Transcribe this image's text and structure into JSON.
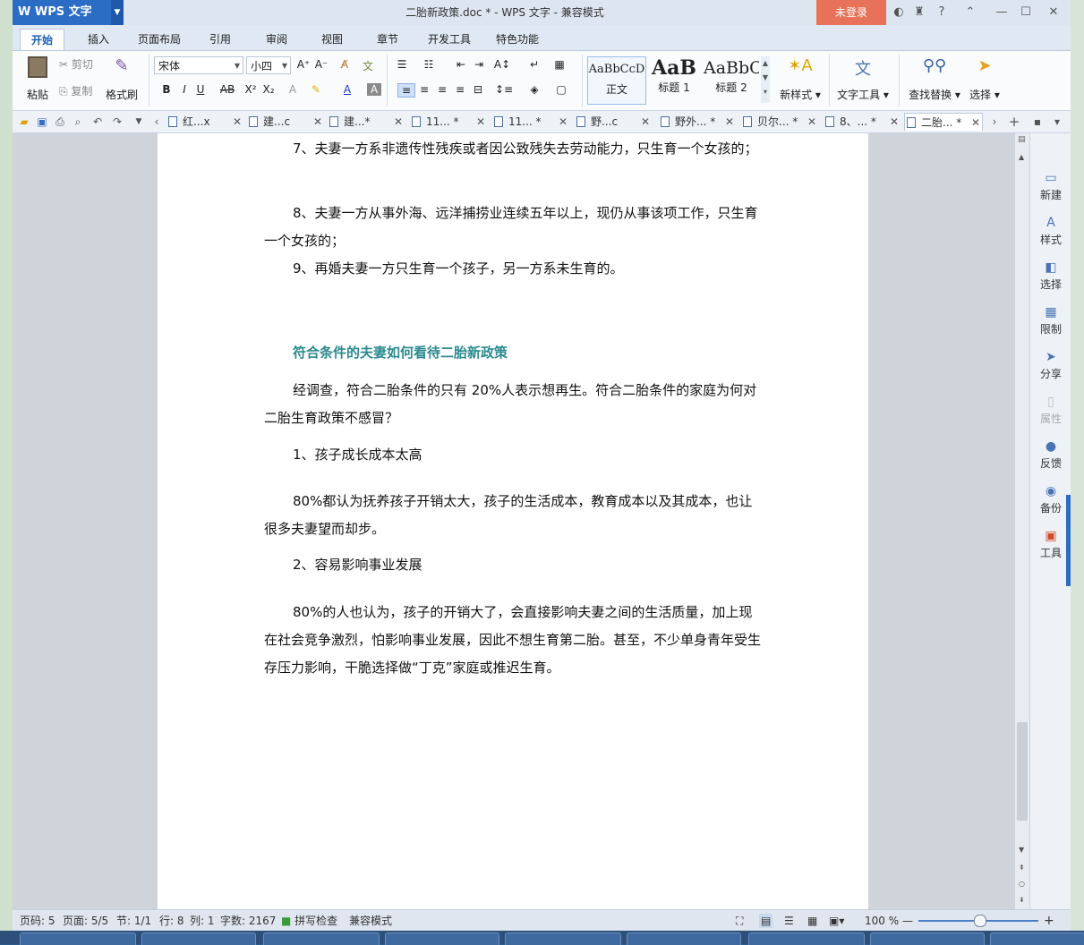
{
  "app": {
    "logo": "WPS 文字",
    "title": "二胎新政策.doc * - WPS 文字 - 兼容模式",
    "login_label": "未登录"
  },
  "menu_tabs": [
    "开始",
    "插入",
    "页面布局",
    "引用",
    "审阅",
    "视图",
    "章节",
    "开发工具",
    "特色功能"
  ],
  "ribbon": {
    "paste": "粘贴",
    "cut": "剪切",
    "copy": "复制",
    "format_painter": "格式刷",
    "font_name": "宋体",
    "font_size": "小四",
    "styles": [
      {
        "sample": "AaBbCcD",
        "label": "正文"
      },
      {
        "sample": "AaB",
        "label": "标题 1"
      },
      {
        "sample": "AaBbC",
        "label": "标题 2"
      }
    ],
    "new_style": "新样式",
    "text_tools": "文字工具",
    "find_replace": "查找替换",
    "select": "选择"
  },
  "doc_tabs": [
    {
      "label": "红...x",
      "active": false
    },
    {
      "label": "建...c",
      "active": false
    },
    {
      "label": "建...*",
      "active": false
    },
    {
      "label": "11... *",
      "active": false
    },
    {
      "label": "11... *",
      "active": false
    },
    {
      "label": "野...c",
      "active": false
    },
    {
      "label": "野外... *",
      "active": false
    },
    {
      "label": "贝尔... *",
      "active": false
    },
    {
      "label": "8、... *",
      "active": false
    },
    {
      "label": "二胎... *",
      "active": true
    }
  ],
  "document": {
    "paragraphs": [
      {
        "text": "7、夫妻一方系非遗传性残疾或者因公致残失去劳动能力，只生育一个女孩的；",
        "heading": false
      },
      {
        "text": "8、夫妻一方从事外海、远洋捕捞业连续五年以上，现仍从事该项工作，只生育一个女孩的；",
        "heading": false
      },
      {
        "text": "9、再婚夫妻一方只生育一个孩子，另一方系未生育的。",
        "heading": false
      },
      {
        "text": "符合条件的夫妻如何看待二胎新政策",
        "heading": true
      },
      {
        "text": "经调查，符合二胎条件的只有 20%人表示想再生。符合二胎条件的家庭为何对二胎生育政策不感冒？",
        "heading": false
      },
      {
        "text": "1、孩子成长成本太高",
        "heading": false
      },
      {
        "text": "80%都认为抚养孩子开销太大，孩子的生活成本，教育成本以及其成本，也让很多夫妻望而却步。",
        "heading": false
      },
      {
        "text": "2、容易影响事业发展",
        "heading": false
      },
      {
        "text": "80%的人也认为，孩子的开销大了，会直接影响夫妻之间的生活质量，加上现在社会竞争激烈，怕影响事业发展，因此不想生育第二胎。甚至，不少单身青年受生存压力影响，干脆选择做“丁克”家庭或推迟生育。",
        "heading": false
      }
    ]
  },
  "right_pane": [
    {
      "label": "新建",
      "icon": "new-doc-icon",
      "enabled": true
    },
    {
      "label": "样式",
      "icon": "style-icon",
      "enabled": true
    },
    {
      "label": "选择",
      "icon": "select-icon",
      "enabled": true
    },
    {
      "label": "限制",
      "icon": "restrict-icon",
      "enabled": true
    },
    {
      "label": "分享",
      "icon": "share-icon",
      "enabled": true
    },
    {
      "label": "属性",
      "icon": "properties-icon",
      "enabled": false
    },
    {
      "label": "反馈",
      "icon": "feedback-icon",
      "enabled": true
    },
    {
      "label": "备份",
      "icon": "backup-icon",
      "enabled": true
    },
    {
      "label": "工具",
      "icon": "tools-icon",
      "enabled": true
    }
  ],
  "status": {
    "page_num": "页码: 5",
    "pages": "页面: 5/5",
    "section": "节: 1/1",
    "row": "行: 8",
    "col": "列: 1",
    "word_count": "字数: 2167",
    "spell_check": "拼写检查",
    "compat_mode": "兼容模式",
    "zoom": "100 %"
  },
  "colors": {
    "accent": "#2b6cc4",
    "login": "#e8715a",
    "heading_text": "#2b8a8e"
  }
}
